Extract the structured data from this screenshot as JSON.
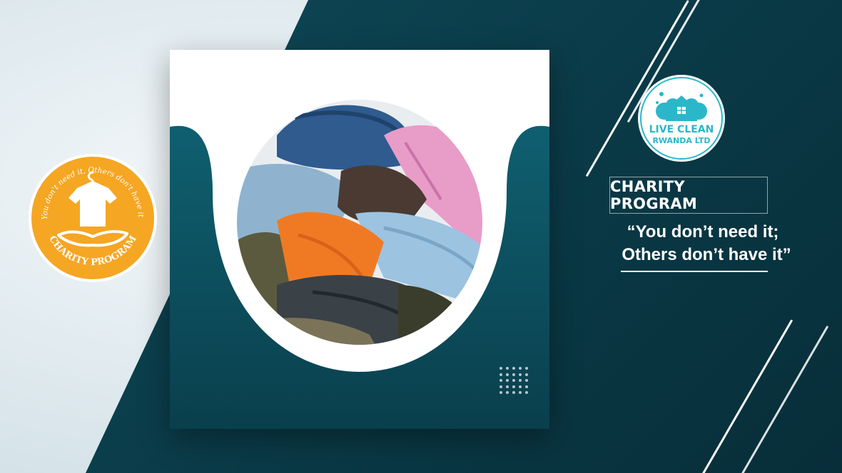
{
  "badge": {
    "ring_text": "\"You don't need it, Others don't have it.\"",
    "bottom_text": "CHARITY PROGRAM",
    "color": "#f5a623",
    "icons": [
      "hanger-icon",
      "tshirt-icon",
      "hand-icon"
    ]
  },
  "logo": {
    "line1": "LIVE CLEAN",
    "line2": "RWANDA LTD",
    "color": "#2bb7c9",
    "icon": "house-cloud-icon"
  },
  "program": {
    "label": "CHARITY PROGRAM"
  },
  "tagline": {
    "line1": "“You don’t need it;",
    "line2": "Others don’t have it”"
  },
  "theme": {
    "dark_teal": "#0a3a47",
    "card_teal": "#0e5565"
  },
  "photo": {
    "subject": "pile-of-clothes-image"
  }
}
